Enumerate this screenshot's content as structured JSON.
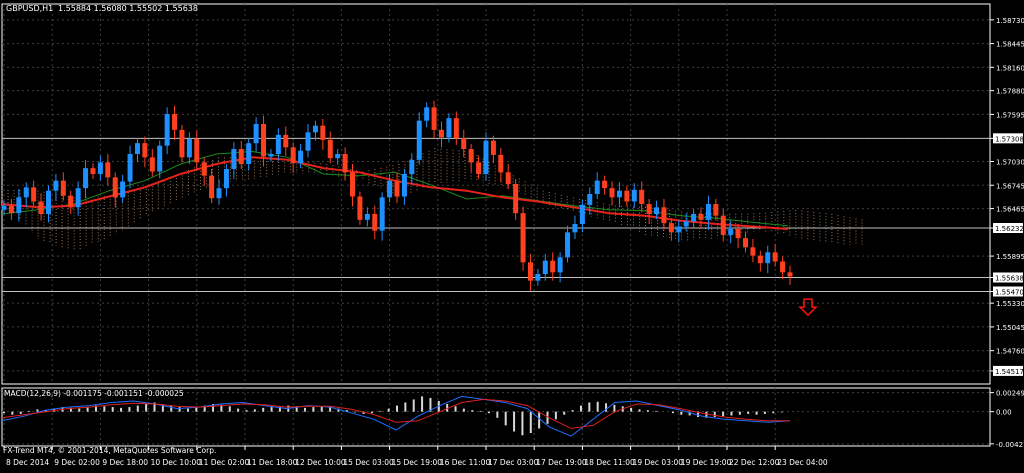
{
  "header": {
    "symbol_label": "GBPUSD,H1",
    "ohlc_label": "1.55884 1.56080 1.55502 1.55638"
  },
  "indicator": {
    "macd_label": "MACD(12,26,9) -0.001175 -0.001151 -0.000025"
  },
  "footer": {
    "copyright": "FX-Trend MT4, © 2001-2014, MetaQuotes Software Corp."
  },
  "colors": {
    "background": "#000000",
    "grid": "#3f3f3f",
    "axis": "#ffffff",
    "bull_candle": "#1e90ff",
    "bear_candle": "#ff4020",
    "ma_slow": "#e8231c",
    "ma_fast": "#1a8a1a",
    "cloud": "#c8926a",
    "level_line": "#c0c0c0",
    "sell_arrow": "#ff1010",
    "macd_hist": "#d8d8d8",
    "macd_line": "#1e6fff",
    "signal_line": "#e02020"
  },
  "icons": {
    "down_arrow": "sell-signal-arrow-icon"
  },
  "chart_data": [
    {
      "type": "candlestick",
      "title": "GBPUSD,H1",
      "ylim": [
        1.5436,
        1.5892
      ],
      "y_ticks": [
        "1.58730",
        "1.58445",
        "1.58160",
        "1.57880",
        "1.57595",
        "1.57308",
        "1.57030",
        "1.56745",
        "1.56465",
        "1.56232",
        "1.55895",
        "1.55638",
        "1.55470",
        "1.55330",
        "1.55045",
        "1.54760",
        "1.54517"
      ],
      "y_tick_values": [
        1.5873,
        1.58445,
        1.5816,
        1.5788,
        1.57595,
        1.57308,
        1.5703,
        1.56745,
        1.56465,
        1.56232,
        1.55895,
        1.55638,
        1.5547,
        1.5533,
        1.55045,
        1.5476,
        1.54517
      ],
      "highlighted_ticks": [
        "1.57308",
        "1.56232",
        "1.55638",
        "1.55470",
        "1.54517"
      ],
      "x_ticks": [
        "8 Dec 2014",
        "9 Dec 02:00",
        "9 Dec 18:00",
        "10 Dec 10:00",
        "11 Dec 02:00",
        "11 Dec 18:00",
        "12 Dec 10:00",
        "15 Dec 03:00",
        "15 Dec 19:00",
        "16 Dec 11:00",
        "17 Dec 03:00",
        "17 Dec 19:00",
        "18 Dec 11:00",
        "19 Dec 03:00",
        "19 Dec 19:00",
        "22 Dec 12:00",
        "23 Dec 04:00"
      ],
      "horizontal_levels": [
        1.57308,
        1.56232,
        1.55638,
        1.5547
      ],
      "close_path": [
        1.565,
        1.5641,
        1.566,
        1.5672,
        1.5655,
        1.564,
        1.5668,
        1.568,
        1.5662,
        1.5648,
        1.5671,
        1.5695,
        1.5688,
        1.5702,
        1.5684,
        1.566,
        1.5679,
        1.5712,
        1.5725,
        1.5708,
        1.5691,
        1.5722,
        1.576,
        1.5741,
        1.5708,
        1.573,
        1.5702,
        1.5686,
        1.5659,
        1.5671,
        1.5694,
        1.5718,
        1.57,
        1.5725,
        1.5748,
        1.5709,
        1.5712,
        1.5735,
        1.572,
        1.5701,
        1.5716,
        1.5738,
        1.5746,
        1.5729,
        1.5707,
        1.5712,
        1.569,
        1.5661,
        1.5633,
        1.564,
        1.562,
        1.566,
        1.568,
        1.5661,
        1.5688,
        1.5705,
        1.5752,
        1.5768,
        1.5741,
        1.5732,
        1.5755,
        1.5731,
        1.5718,
        1.5702,
        1.5688,
        1.5728,
        1.5711,
        1.569,
        1.5676,
        1.5641,
        1.5582,
        1.556,
        1.5568,
        1.5584,
        1.557,
        1.5588,
        1.5618,
        1.5628,
        1.5651,
        1.5664,
        1.568,
        1.5671,
        1.566,
        1.5668,
        1.5655,
        1.5669,
        1.5652,
        1.564,
        1.5648,
        1.5629,
        1.5618,
        1.5625,
        1.5631,
        1.564,
        1.5633,
        1.5652,
        1.5638,
        1.5615,
        1.5622,
        1.5611,
        1.56,
        1.559,
        1.5581,
        1.5594,
        1.5583,
        1.557,
        1.5565
      ],
      "ma_slow_path": [
        1.5652,
        1.5648,
        1.565,
        1.5661,
        1.5672,
        1.5688,
        1.57,
        1.5708,
        1.5705,
        1.5695,
        1.569,
        1.568,
        1.5672,
        1.5668,
        1.566,
        1.5655,
        1.5648,
        1.5641,
        1.5638,
        1.5632,
        1.5628,
        1.5625,
        1.5622
      ],
      "ma_fast_path": [
        1.564,
        1.5645,
        1.5652,
        1.5668,
        1.568,
        1.57,
        1.5712,
        1.5715,
        1.5708,
        1.5688,
        1.5686,
        1.569,
        1.5675,
        1.5658,
        1.5662,
        1.5656,
        1.565,
        1.5645,
        1.5644,
        1.5638,
        1.5635,
        1.563,
        1.5626
      ],
      "cloud_upper": [
        1.5669,
        1.5668,
        1.566,
        1.5662,
        1.567,
        1.569,
        1.5708,
        1.5708,
        1.5705,
        1.57,
        1.5691,
        1.57,
        1.5719,
        1.5715,
        1.569,
        1.5668,
        1.5658,
        1.565,
        1.5648,
        1.5642,
        1.564,
        1.5641,
        1.5645,
        1.564,
        1.5632
      ],
      "cloud_lower": [
        1.5655,
        1.561,
        1.5595,
        1.5612,
        1.5638,
        1.566,
        1.5677,
        1.5682,
        1.569,
        1.5686,
        1.568,
        1.566,
        1.5676,
        1.568,
        1.5671,
        1.5652,
        1.564,
        1.563,
        1.5612,
        1.5608,
        1.5612,
        1.562,
        1.5612,
        1.5604,
        1.5602
      ],
      "sell_signal_arrow_price": 1.5527
    },
    {
      "type": "bar",
      "title": "MACD(12,26,9) -0.001175 -0.001151 -0.000025",
      "y_ticks": [
        "0.002492",
        "0.00",
        "-0.004217"
      ],
      "y_tick_values": [
        0.002492,
        0.0,
        -0.004217
      ],
      "ylim": [
        -0.0045,
        0.0031
      ],
      "histogram": [
        -0.0002,
        -0.0004,
        -0.0003,
        0.0001,
        0.0003,
        0.0002,
        0.0004,
        0.0006,
        0.0005,
        0.0004,
        0.0006,
        0.0008,
        0.0007,
        0.0006,
        0.0005,
        0.0006,
        0.0008,
        0.001,
        0.0012,
        0.001,
        0.0008,
        0.0006,
        0.0004,
        0.0006,
        0.0008,
        0.001,
        0.0009,
        0.0007,
        0.0004,
        0.0002,
        0.0003,
        0.0005,
        0.0006,
        0.0007,
        0.0008,
        0.0007,
        0.0005,
        0.0006,
        0.0007,
        0.0006,
        0.0004,
        0.0002,
        -0.0001,
        -0.0003,
        -0.0002,
        0.0001,
        0.0004,
        0.0008,
        0.0012,
        0.0016,
        0.002,
        0.0018,
        0.0014,
        0.001,
        0.0007,
        0.0004,
        0.0002,
        0.0001,
        -0.0002,
        -0.0008,
        -0.0018,
        -0.0026,
        -0.0031,
        -0.0028,
        -0.0022,
        -0.0016,
        -0.001,
        -0.0004,
        0.0002,
        0.0008,
        0.0012,
        0.0013,
        0.0011,
        0.0009,
        0.0007,
        0.0005,
        0.0003,
        0.0002,
        0.0001,
        0.0,
        -0.0002,
        -0.0004,
        -0.0005,
        -0.0007,
        -0.0008,
        -0.0007,
        -0.0006,
        -0.0005,
        -0.0004,
        -0.0003,
        -0.0004,
        -0.0003,
        -0.0002,
        -0.0001,
        0.0
      ],
      "macd_line": [
        -0.0012,
        -0.0006,
        0.0002,
        0.0006,
        0.0008,
        0.0012,
        0.0014,
        0.001,
        0.0004,
        0.0006,
        0.001,
        0.0012,
        0.0008,
        0.0004,
        0.0008,
        0.0006,
        -0.0002,
        -0.001,
        -0.0024,
        -0.0006,
        0.0008,
        0.002,
        0.0016,
        0.0012,
        0.0004,
        -0.002,
        -0.0032,
        -0.001,
        0.0012,
        0.0014,
        0.0008,
        0.0002,
        -0.0006,
        -0.001,
        -0.0012,
        -0.0014,
        -0.0012
      ],
      "signal_line": [
        -0.0008,
        -0.0004,
        0.0,
        0.0004,
        0.0006,
        0.0009,
        0.0011,
        0.001,
        0.0007,
        0.0006,
        0.0008,
        0.001,
        0.0009,
        0.0006,
        0.0007,
        0.0007,
        0.0003,
        -0.0004,
        -0.0014,
        -0.0012,
        0.0,
        0.0012,
        0.0016,
        0.0014,
        0.0008,
        -0.0008,
        -0.0022,
        -0.0018,
        0.0,
        0.001,
        0.0009,
        0.0004,
        -0.0002,
        -0.0007,
        -0.001,
        -0.0012,
        -0.0012
      ]
    }
  ]
}
